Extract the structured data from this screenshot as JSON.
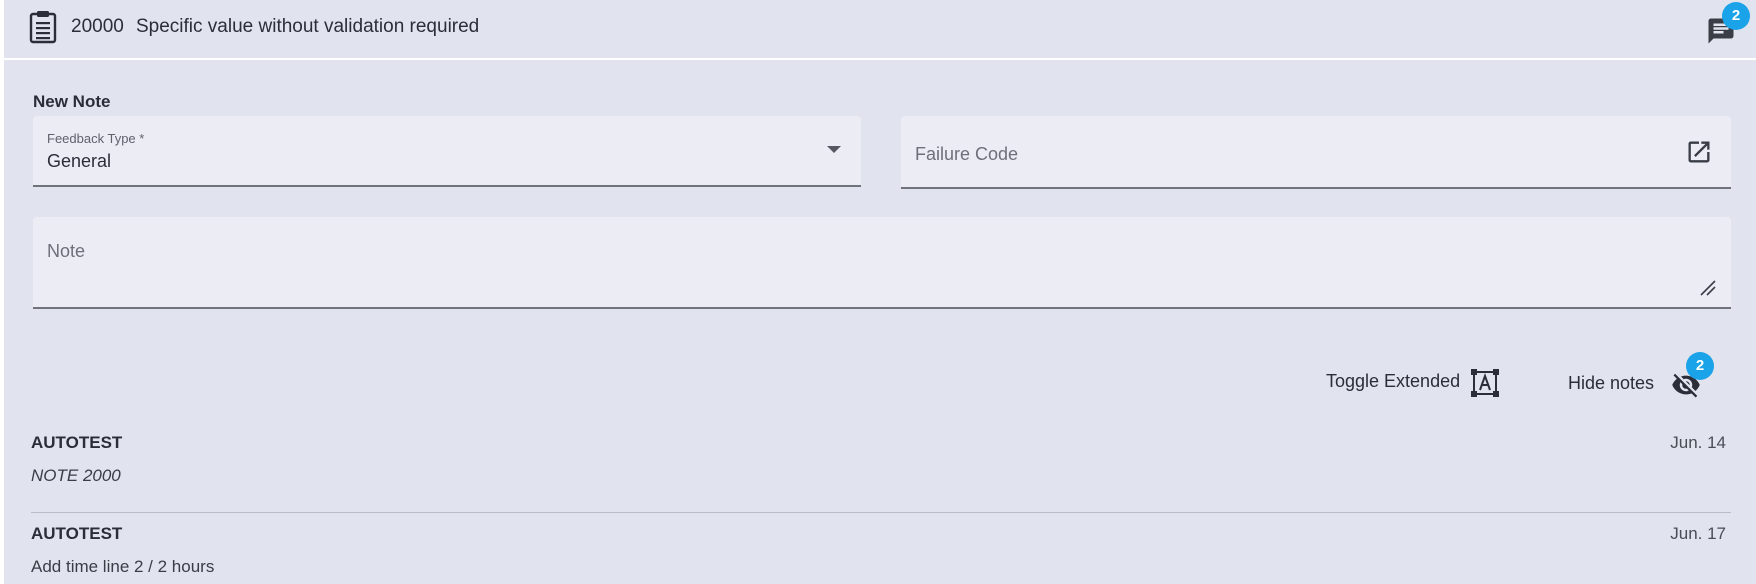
{
  "header": {
    "task_id": "20000",
    "task_title": "Specific value without validation required",
    "clipboard_icon": "clipboard-icon",
    "comments_icon": "comments-icon",
    "comments_badge": "2"
  },
  "new_note": {
    "title": "New Note",
    "feedback_type": {
      "label": "Feedback Type *",
      "value": "General",
      "icon": "dropdown-caret-icon"
    },
    "failure_code": {
      "placeholder": "Failure Code",
      "icon": "open-in-new-icon"
    },
    "note": {
      "placeholder": "Note",
      "icon": "resize-grip-icon"
    }
  },
  "actions": {
    "toggle_extended_label": "Toggle Extended",
    "toggle_extended_icon": "text-select-icon",
    "hide_notes_label": "Hide notes",
    "hide_notes_icon": "eye-off-icon",
    "hide_notes_badge": "2"
  },
  "notes": [
    {
      "author": "AUTOTEST",
      "date": "Jun. 14",
      "text": "NOTE 2000"
    },
    {
      "author": "AUTOTEST",
      "date": "Jun. 17",
      "text": "Add time line 2 / 2 hours"
    }
  ],
  "colors": {
    "background": "#e1e3ee",
    "field_background": "#ebecf4",
    "badge": "#1aa3e8",
    "text": "#2b2e38"
  }
}
